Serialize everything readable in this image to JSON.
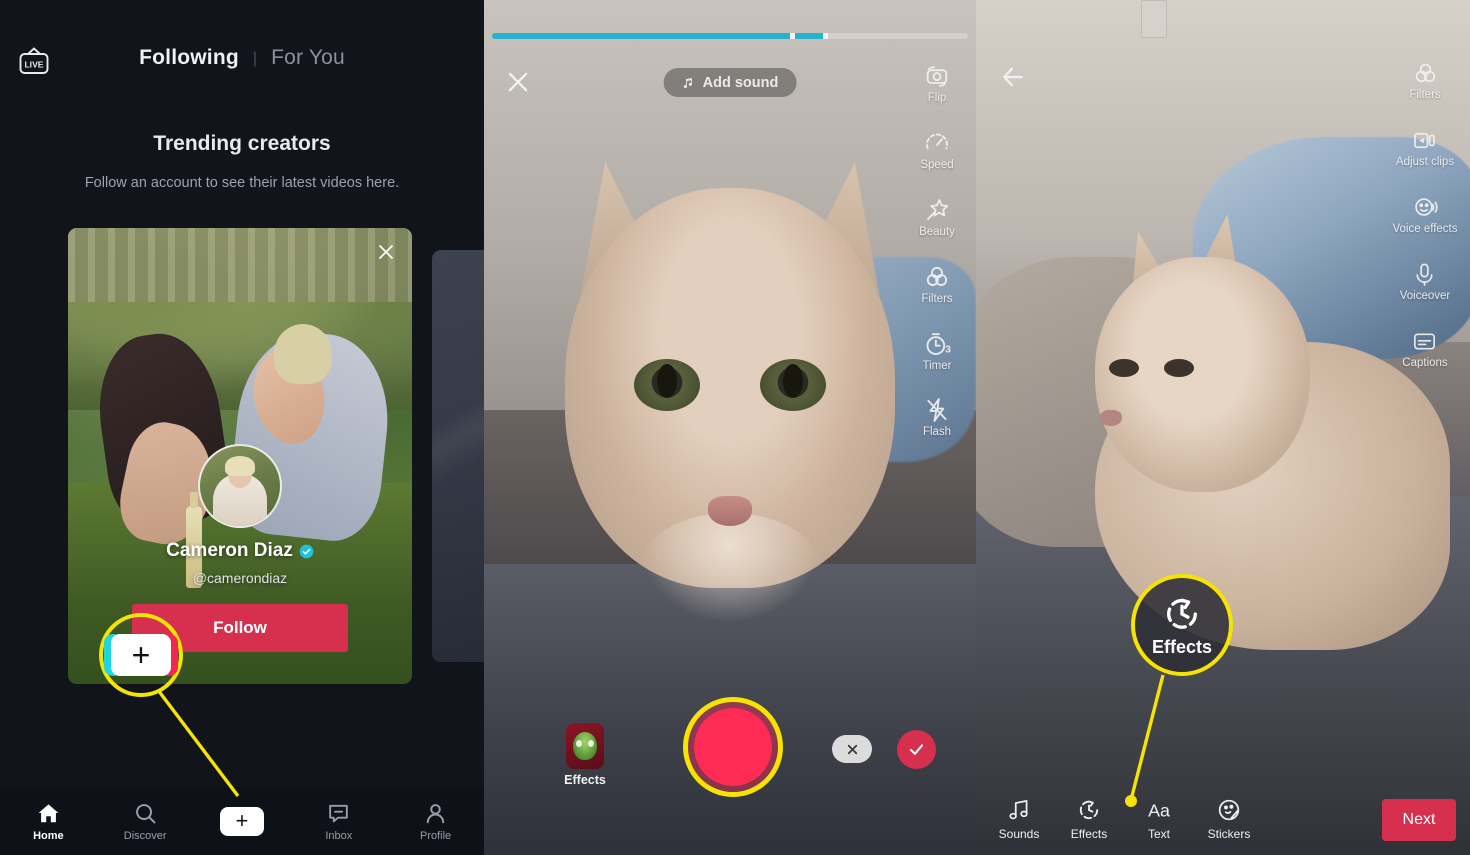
{
  "panel1": {
    "name": "tiktok-following-feed",
    "live_icon": "live-tv-icon",
    "tabs": {
      "following": "Following",
      "divider": "|",
      "for_you": "For You"
    },
    "trending": {
      "title": "Trending creators",
      "subtitle": "Follow an account to see their latest videos here."
    },
    "creator_card": {
      "close_icon": "close-icon",
      "display_name": "Cameron Diaz",
      "verified_icon": "verified-badge-icon",
      "handle": "@camerondiaz",
      "follow_label": "Follow"
    },
    "nav": [
      {
        "label": "Home",
        "icon": "home-icon",
        "active": true
      },
      {
        "label": "Discover",
        "icon": "search-icon",
        "active": false
      },
      {
        "label": "",
        "icon": "plus-icon",
        "active": false
      },
      {
        "label": "Inbox",
        "icon": "inbox-message-icon",
        "active": false
      },
      {
        "label": "Profile",
        "icon": "person-icon",
        "active": false
      }
    ],
    "callout": {
      "icon": "plus-create-icon",
      "target": "create-button"
    }
  },
  "panel2": {
    "name": "tiktok-camera-recorder",
    "progress": {
      "percent": 66,
      "segments": [
        63,
        75
      ]
    },
    "close_icon": "close-icon",
    "add_sound": {
      "label": "Add sound",
      "icon": "music-note-icon"
    },
    "rail": [
      {
        "label": "Flip",
        "icon": "flip-camera-icon"
      },
      {
        "label": "Speed",
        "icon": "speed-gauge-icon"
      },
      {
        "label": "Beauty",
        "icon": "beauty-wand-icon"
      },
      {
        "label": "Filters",
        "icon": "filters-circles-icon"
      },
      {
        "label": "Timer",
        "icon": "timer-3s-icon"
      },
      {
        "label": "Flash",
        "icon": "flash-off-icon"
      }
    ],
    "effects_label": "Effects",
    "effects_icon": "alien-face-effect-icon",
    "record_button": "record-button",
    "delete_icon": "delete-x-icon",
    "confirm_icon": "check-icon"
  },
  "panel3": {
    "name": "tiktok-post-edit",
    "back_icon": "back-arrow-icon",
    "rail": [
      {
        "label": "Filters",
        "icon": "filters-circles-icon"
      },
      {
        "label": "Adjust clips",
        "icon": "adjust-clips-icon"
      },
      {
        "label": "Voice effects",
        "icon": "voice-effects-icon"
      },
      {
        "label": "Voiceover",
        "icon": "microphone-icon"
      },
      {
        "label": "Captions",
        "icon": "captions-icon"
      }
    ],
    "tools": [
      {
        "label": "Sounds",
        "icon": "music-note-icon"
      },
      {
        "label": "Effects",
        "icon": "effects-clock-icon"
      },
      {
        "label": "Text",
        "icon": "text-aa-icon"
      },
      {
        "label": "Stickers",
        "icon": "sticker-face-icon"
      }
    ],
    "next_label": "Next",
    "callout": {
      "label": "Effects",
      "icon": "effects-clock-icon",
      "target": "effects-tool"
    }
  },
  "colors": {
    "accent_red": "#d7304f",
    "record_red": "#fe2c55",
    "callout_yellow": "#f5e400",
    "progress_cyan": "#27b3cc",
    "panel1_bg": "#12141c",
    "tiktok_cyan": "#20d5e3"
  }
}
